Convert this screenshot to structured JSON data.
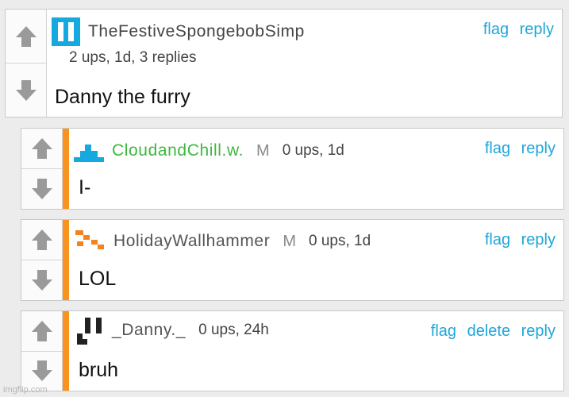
{
  "colors": {
    "link": "#1fa6d9",
    "accent": "#f7931e",
    "green_user": "#3db83d",
    "icon_blue": "#15a9e0",
    "icon_orange": "#f5821f",
    "icon_black": "#222222"
  },
  "comments": [
    {
      "username": "TheFestiveSpongebobSimp",
      "avatar_icon": "blue-pause-icon",
      "stats": "2 ups, 1d, 3 replies",
      "text": "Danny the furry",
      "actions": [
        "flag",
        "reply"
      ]
    },
    {
      "username": "CloudandChill.w.",
      "avatar_icon": "blue-stairs-icon",
      "mod_badge": "M",
      "stats": "0 ups, 1d",
      "text": "I-",
      "actions": [
        "flag",
        "reply"
      ]
    },
    {
      "username": "HolidayWallhammer",
      "avatar_icon": "orange-pixel-icon",
      "mod_badge": "M",
      "stats": "0 ups, 1d",
      "text": "LOL",
      "actions": [
        "flag",
        "reply"
      ]
    },
    {
      "username": "_Danny._",
      "avatar_icon": "black-pixel-icon",
      "stats": "0 ups, 24h",
      "text": "bruh",
      "actions": [
        "flag",
        "delete",
        "reply"
      ]
    }
  ],
  "watermark": "imgflip.com"
}
